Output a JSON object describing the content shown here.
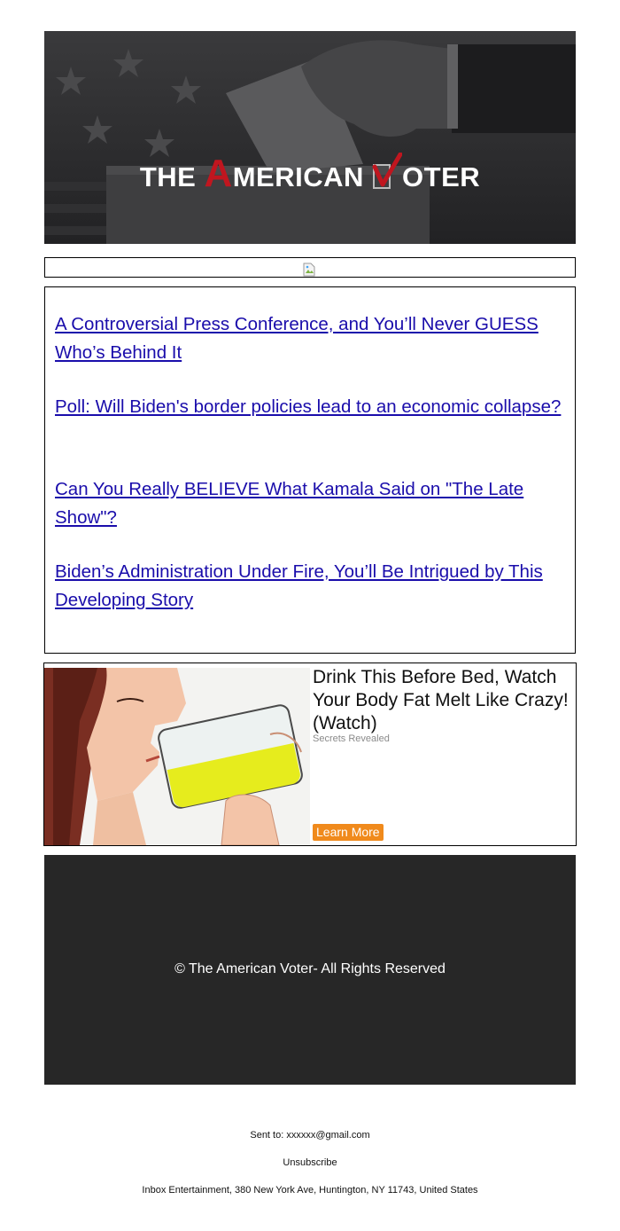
{
  "banner": {
    "logo_the": "THE",
    "logo_a": "A",
    "logo_merican": "MERICAN",
    "logo_v": "V",
    "logo_oter": "OTER",
    "logo_icon": "checkmark-ballot-icon",
    "colors": {
      "background": "#2c2c2e",
      "logo_text": "#ffffff",
      "logo_accent": "#c0161f"
    }
  },
  "image_strip": {
    "icon": "broken-image-icon"
  },
  "articles": [
    {
      "title": "A Controversial Press Conference, and You’ll Never GUESS Who’s Behind It"
    },
    {
      "title": "Poll: Will Biden's border policies lead to an economic collapse?"
    },
    {
      "title": "Can You Really BELIEVE What Kamala Said on \"The Late Show\"?"
    },
    {
      "title": "Biden’s Administration Under Fire, You’ll Be Intrigued by This Developing Story"
    }
  ],
  "ad": {
    "title": "Drink This Before Bed, Watch Your Body Fat Melt Like Crazy! (Watch)",
    "source": "Secrets Revealed",
    "cta": "Learn More",
    "image": "woman-drinking-glass-illustration",
    "colors": {
      "cta_background": "#f08a1c"
    }
  },
  "footer": {
    "copyright": "© The American Voter- All Rights Reserved",
    "sent_to": "Sent to: xxxxxx@gmail.com",
    "unsubscribe": "Unsubscribe",
    "address": "Inbox Entertainment, 380 New York Ave, Huntington, NY 11743, United States",
    "colors": {
      "panel_background": "#272727",
      "link": "#1a0dab"
    }
  }
}
